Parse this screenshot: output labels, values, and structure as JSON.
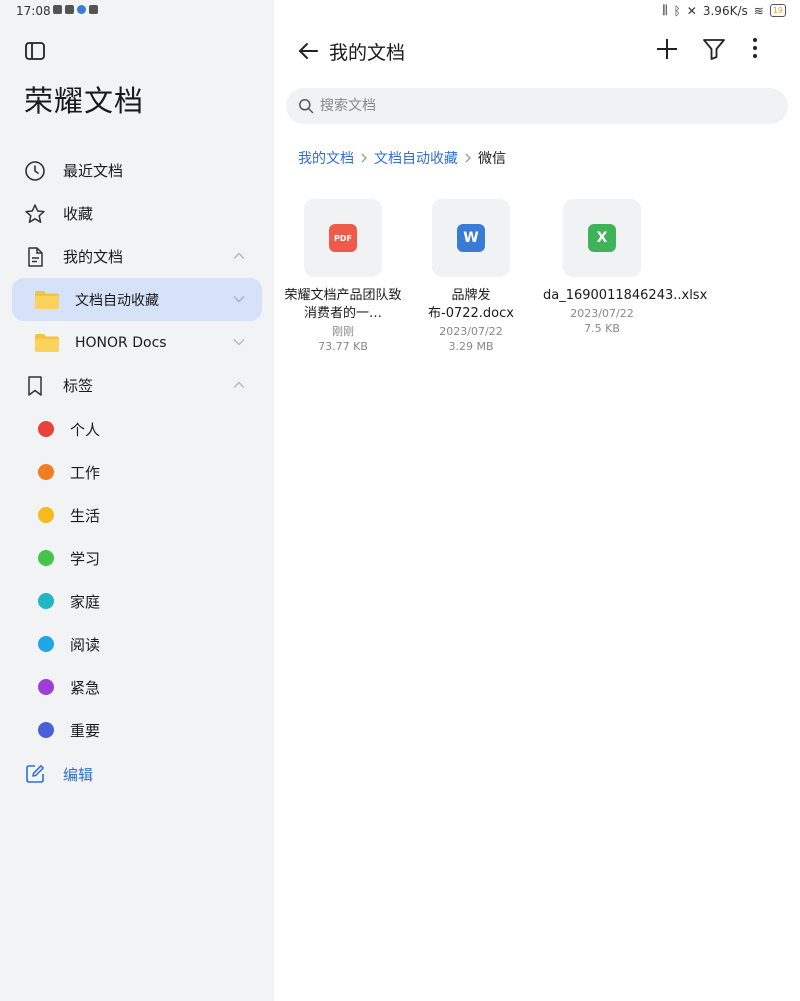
{
  "status_bar": {
    "time": "17:08",
    "network_speed": "3.96K/s",
    "battery": "19"
  },
  "app": {
    "title": "荣耀文档"
  },
  "sidebar": {
    "nav": [
      {
        "label": "最近文档",
        "icon": "clock-icon"
      },
      {
        "label": "收藏",
        "icon": "star-icon"
      },
      {
        "label": "我的文档",
        "icon": "document-icon"
      }
    ],
    "folders": [
      {
        "label": "文档自动收藏",
        "icon": "folder-icon"
      },
      {
        "label": "HONOR Docs",
        "icon": "folder-icon"
      }
    ],
    "tags_label": "标签",
    "tags": [
      {
        "label": "个人",
        "color": "#e8413a"
      },
      {
        "label": "工作",
        "color": "#f07d22"
      },
      {
        "label": "生活",
        "color": "#f5bb1b"
      },
      {
        "label": "学习",
        "color": "#47c44b"
      },
      {
        "label": "家庭",
        "color": "#1fb8c2"
      },
      {
        "label": "阅读",
        "color": "#1ea6e8"
      },
      {
        "label": "紧急",
        "color": "#9b3fd6"
      },
      {
        "label": "重要",
        "color": "#4a5fd9"
      }
    ],
    "edit_label": "编辑"
  },
  "main": {
    "title": "我的文档",
    "search_placeholder": "搜索文档",
    "breadcrumb": [
      "我的文档",
      "文档自动收藏",
      "微信"
    ],
    "files": [
      {
        "name": "荣耀文档产品团队致消费者的一…",
        "date": "刚刚",
        "size": "73.77 KB",
        "type": "pdf",
        "badge": "PDF"
      },
      {
        "name": "品牌发布-0722.docx",
        "date": "2023/07/22",
        "size": "3.29 MB",
        "type": "word",
        "badge": "W"
      },
      {
        "name": "da_1690011846243..xlsx",
        "date": "2023/07/22",
        "size": "7.5 KB",
        "type": "excel",
        "badge": "X"
      }
    ]
  },
  "colors": {
    "accent": "#2f6fd0",
    "active_bg": "#d6e2f7",
    "sidebar_bg": "#f1f3f5"
  }
}
